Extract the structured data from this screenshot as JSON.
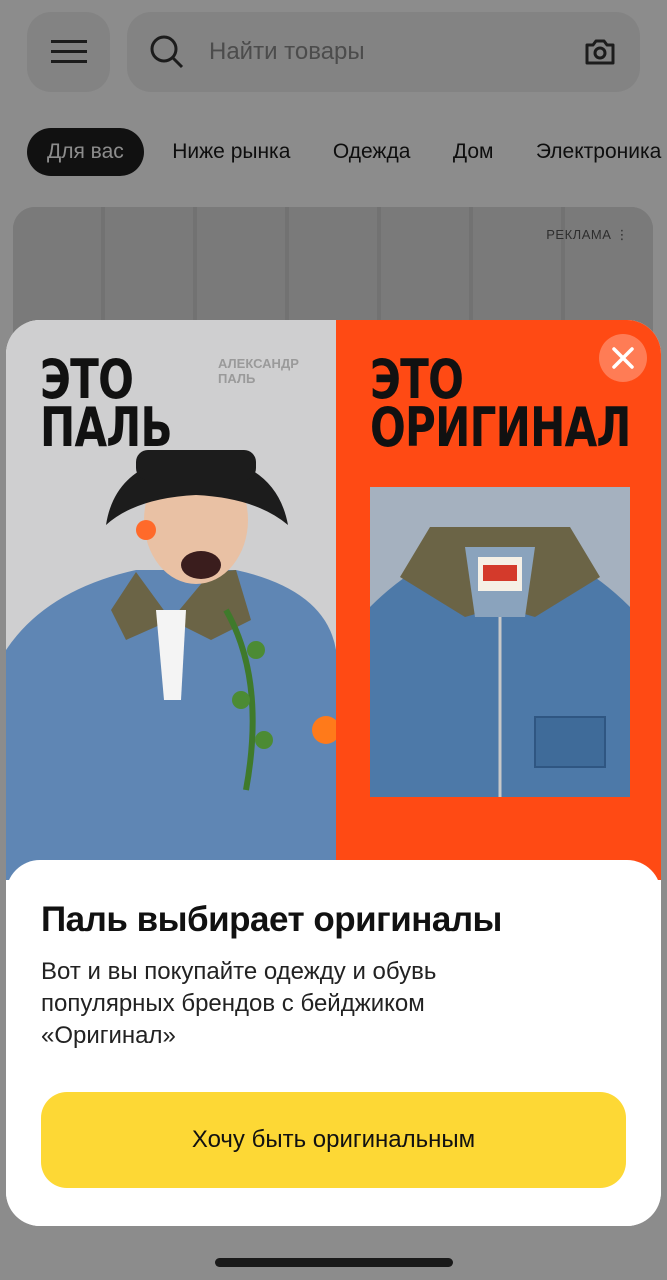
{
  "header": {
    "search_placeholder": "Найти товары"
  },
  "categories": [
    "Для вас",
    "Ниже рынка",
    "Одежда",
    "Дом",
    "Электроника"
  ],
  "banner": {
    "ad_label": "РЕКЛАМА ⋮"
  },
  "popup": {
    "left_heading_line1": "ЭТО",
    "left_heading_line2": "ПАЛЬ",
    "author_line1": "АЛЕКСАНДР",
    "author_line2": "ПАЛЬ",
    "right_heading_line1": "ЭТО",
    "right_heading_line2": "ОРИГИНАЛ",
    "title": "Паль выбирает оригиналы",
    "description": "Вот и вы покупайте одежду и обувь популярных брендов с бейджиком «Оригинал»",
    "cta_label": "Хочу быть оригинальным"
  },
  "colors": {
    "accent_orange": "#ff4a14",
    "cta_yellow": "#fdd835"
  },
  "icons": [
    "menu-icon",
    "search-icon",
    "camera-icon",
    "close-icon"
  ]
}
